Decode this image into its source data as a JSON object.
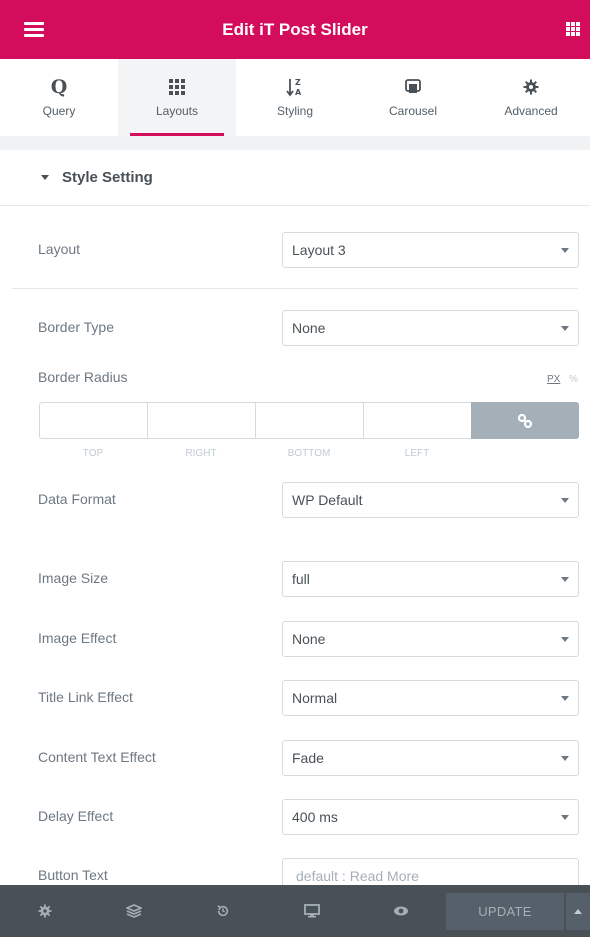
{
  "header": {
    "title": "Edit iT Post Slider",
    "menu_icon": "hamburger-icon",
    "apps_icon": "grid-icon"
  },
  "tabs": [
    {
      "label": "Query",
      "icon": "query-icon",
      "active": false
    },
    {
      "label": "Layouts",
      "icon": "layouts-icon",
      "active": true
    },
    {
      "label": "Styling",
      "icon": "sort-icon",
      "active": false
    },
    {
      "label": "Carousel",
      "icon": "carousel-icon",
      "active": false
    },
    {
      "label": "Advanced",
      "icon": "gear-icon",
      "active": false
    }
  ],
  "section": {
    "title": "Style Setting"
  },
  "fields": {
    "layout": {
      "label": "Layout",
      "value": "Layout 3"
    },
    "border_type": {
      "label": "Border Type",
      "value": "None"
    },
    "border_radius": {
      "label": "Border Radius",
      "unit_px": "PX",
      "unit_pct": "%",
      "sides": [
        "TOP",
        "RIGHT",
        "BOTTOM",
        "LEFT"
      ]
    },
    "data_format": {
      "label": "Data Format",
      "value": "WP Default"
    },
    "image_size": {
      "label": "Image Size",
      "value": "full"
    },
    "image_effect": {
      "label": "Image Effect",
      "value": "None"
    },
    "title_link_effect": {
      "label": "Title Link Effect",
      "value": "Normal"
    },
    "content_text_effect": {
      "label": "Content Text Effect",
      "value": "Fade"
    },
    "delay_effect": {
      "label": "Delay Effect",
      "value": "400 ms"
    },
    "button_text": {
      "label": "Button Text",
      "placeholder": "default : Read More"
    }
  },
  "footer": {
    "update_label": "UPDATE",
    "icons": [
      "settings-icon",
      "navigator-icon",
      "history-icon",
      "responsive-icon",
      "preview-icon"
    ]
  },
  "colors": {
    "accent": "#d30c5c",
    "footer": "#495157"
  }
}
